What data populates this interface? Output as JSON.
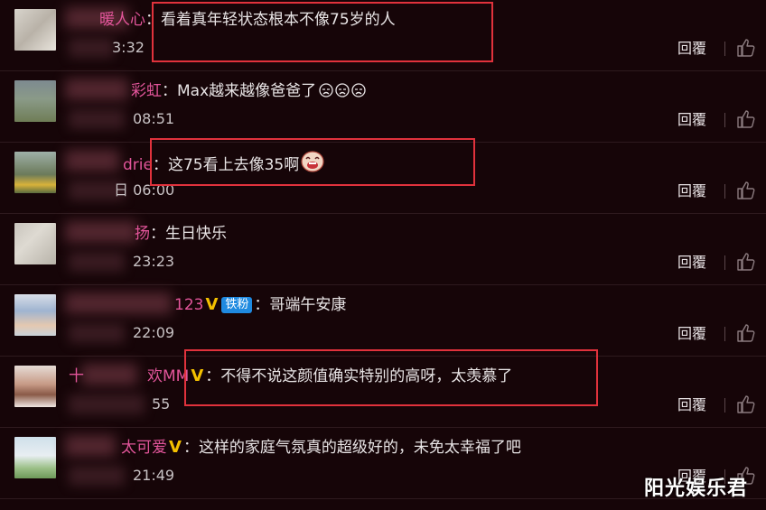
{
  "comments": [
    {
      "username": "暖人心",
      "text": "看着真年轻状态根本不像75岁的人",
      "time": "3:32",
      "reply_label": "回覆"
    },
    {
      "username": "彩虹",
      "text": "Max越来越像爸爸了",
      "time": "08:51",
      "reply_label": "回覆"
    },
    {
      "username": "drie",
      "text": "这75看上去像35啊",
      "time": "日 06:00",
      "reply_label": "回覆"
    },
    {
      "username": "扬",
      "text": "生日快乐",
      "time": "23:23",
      "reply_label": "回覆"
    },
    {
      "username": "123",
      "fan_badge": "铁粉",
      "text": "哥端午安康",
      "time": "22:09",
      "reply_label": "回覆"
    },
    {
      "username_prefix": "十",
      "username": "欢MM",
      "text": "不得不说这颜值确实特别的高呀，太羡慕了",
      "time": "55",
      "reply_label": "回覆"
    },
    {
      "username": "太可爱",
      "text": "这样的家庭气氛真的超级好的，未免太幸福了吧",
      "time": "21:49",
      "reply_label": "回覆"
    }
  ],
  "verified_badge": "V",
  "watermark": "阳光娱乐君",
  "colors": {
    "background": "#160508",
    "username": "#e2559a",
    "text": "#e8e4e5",
    "highlight": "#e0323c",
    "verified": "#f4c000",
    "fan_badge": "#1f8ae0"
  },
  "icons": [
    "thumbs-up-icon",
    "crying-face-emoji",
    "laughing-face-emoji"
  ]
}
